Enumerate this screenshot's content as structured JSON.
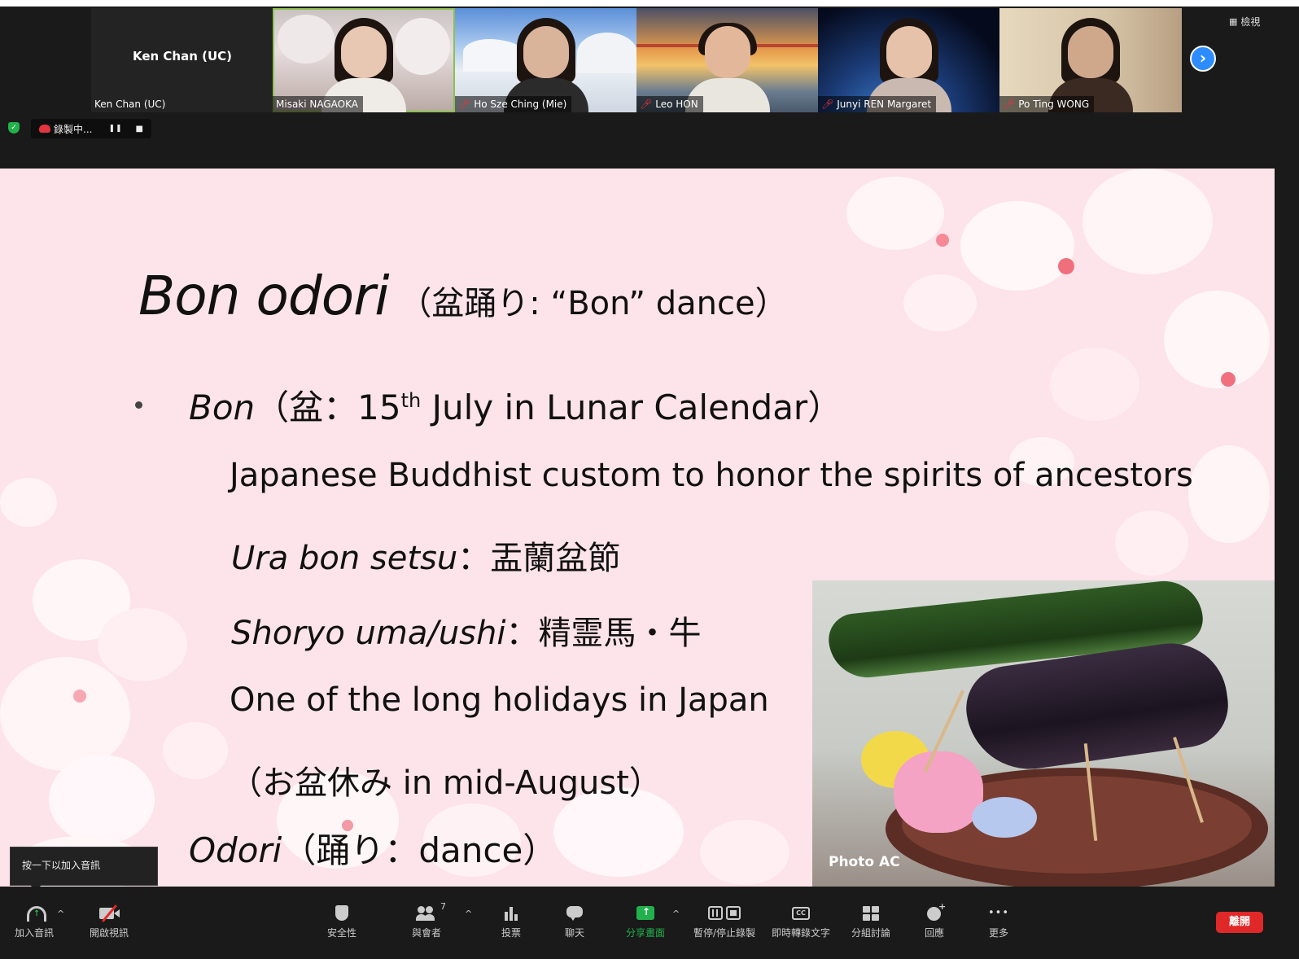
{
  "participants": [
    {
      "name": "Ken Chan (UC)",
      "center_name": "Ken Chan (UC)",
      "video": false,
      "muted": false,
      "active": false
    },
    {
      "name": "Misaki NAGAOKA",
      "video": true,
      "muted": false,
      "active": true
    },
    {
      "name": "Ho Sze Ching (Mie)",
      "video": true,
      "muted": true,
      "active": false
    },
    {
      "name": "Leo HON",
      "video": true,
      "muted": true,
      "active": false
    },
    {
      "name": "Junyi REN Margaret",
      "video": true,
      "muted": true,
      "active": false
    },
    {
      "name": "Po Ting WONG",
      "video": true,
      "muted": true,
      "active": false
    }
  ],
  "view_label": "檢視",
  "recording": {
    "label": "錄製中...",
    "pause_glyph": "❚❚",
    "stop_glyph": "■"
  },
  "slide": {
    "title_main": "Bon odori",
    "title_rest": "（盆踊り: “Bon” dance）",
    "bullet1_term": "Bon",
    "bullet1_rest_a": "（盆：15",
    "bullet1_sup": "th",
    "bullet1_rest_b": " July in Lunar Calendar）",
    "line1": "Japanese Buddhist custom to honor the spirits of ancestors",
    "line2_term": "Ura bon setsu",
    "line2_rest": "：盂蘭盆節",
    "line3_term": "Shoryo uma/ushi",
    "line3_rest": "：精霊馬・牛",
    "line4": "One of the long holidays in Japan",
    "line5": "（お盆休み in mid-August）",
    "bullet2_term": "Odori",
    "bullet2_rest": "（踊り：dance）",
    "photo_credit": "Photo AC"
  },
  "tooltip": "按一下以加入音訊",
  "toolbar": {
    "join_audio": "加入音訊",
    "start_video": "開啟視訊",
    "security": "安全性",
    "participants": "與會者",
    "participants_count": "7",
    "polls": "投票",
    "chat": "聊天",
    "share_screen": "分享畫面",
    "pause_stop_recording": "暫停/停止錄製",
    "live_transcript": "即時轉錄文字",
    "breakout_rooms": "分組討論",
    "reactions": "回應",
    "more": "更多",
    "end": "離開",
    "caret": "^",
    "cc": "CC",
    "more_glyph": "•••"
  },
  "colors": {
    "accent_blue": "#2d8cff",
    "end_red": "#e02828",
    "share_green": "#22b14c",
    "slide_pink": "#fde3ea",
    "mute_red": "#e8333c"
  }
}
